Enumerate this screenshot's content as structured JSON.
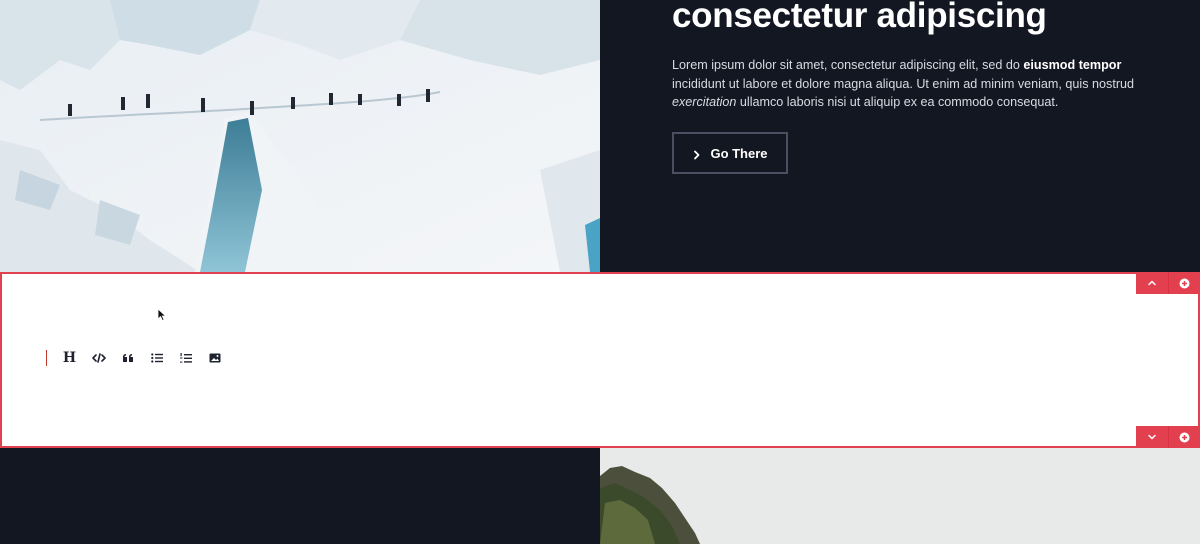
{
  "hero": {
    "heading": "consectetur adipiscing",
    "paragraph": {
      "part1": "Lorem ipsum dolor sit amet, consectetur adipiscing elit, sed do ",
      "bold": "eiusmod tempor",
      "part2": " incididunt ut labore et dolore magna aliqua. Ut enim ad minim veniam, quis nostrud ",
      "italic": "exercitation",
      "part3": " ullamco laboris nisi ut aliquip ex ea commodo consequat."
    },
    "button_label": "Go There",
    "button_icon": "chevron-right-icon",
    "image": "glacier-climbers-photo"
  },
  "editor": {
    "toolbar": [
      {
        "name": "heading",
        "icon": "heading-icon",
        "glyph": "H"
      },
      {
        "name": "code",
        "icon": "code-icon"
      },
      {
        "name": "quote",
        "icon": "quote-icon"
      },
      {
        "name": "bullet-list",
        "icon": "bullet-list-icon"
      },
      {
        "name": "numbered-list",
        "icon": "numbered-list-icon"
      },
      {
        "name": "image",
        "icon": "image-icon"
      }
    ],
    "controls_top": [
      "chevron-up-icon",
      "add-circle-icon"
    ],
    "controls_bottom": [
      "chevron-down-icon",
      "add-circle-icon"
    ],
    "accent_color": "#e2404f"
  },
  "bottom": {
    "image": "mountain-landscape-photo"
  },
  "colors": {
    "background": "#131722",
    "button_border": "#4a5061",
    "text_light": "#d8dbe2"
  }
}
